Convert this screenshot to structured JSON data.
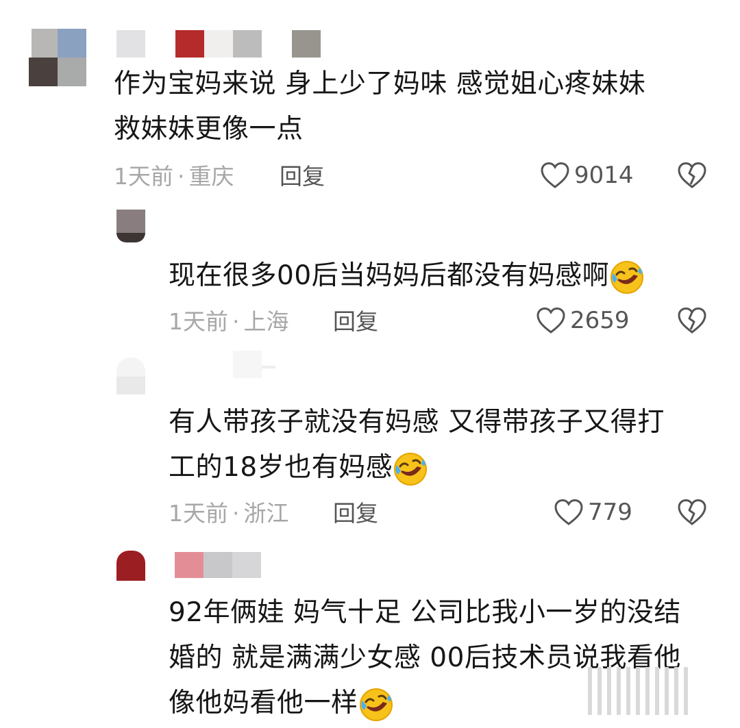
{
  "comments": [
    {
      "text_lines": [
        "作为宝妈来说  身上少了妈味  感觉姐心疼妹妹",
        "救妹妹更像一点"
      ],
      "time": "1天前",
      "location": "重庆",
      "reply_label": "回复",
      "likes": "9014",
      "has_emoji": false
    },
    {
      "text_lines": [
        "现在很多00后当妈妈后都没有妈感啊"
      ],
      "time": "1天前",
      "location": "上海",
      "reply_label": "回复",
      "likes": "2659",
      "has_emoji": true
    },
    {
      "text_lines": [
        "有人带孩子就没有妈感  又得带孩子又得打",
        "工的18岁也有妈感"
      ],
      "time": "1天前",
      "location": "浙江",
      "reply_label": "回复",
      "likes": "779",
      "has_emoji": true
    },
    {
      "text_lines": [
        "92年俩娃  妈气十足  公司比我小一岁的没结",
        "婚的  就是满满少女感  00后技术员说我看他",
        "像他妈看他一样"
      ],
      "has_emoji": true
    }
  ],
  "meta_separator": "·",
  "icons": {
    "like": "heart-outline-icon",
    "dislike": "broken-heart-icon",
    "emoji": "rolling-on-floor-laughing-emoji"
  }
}
